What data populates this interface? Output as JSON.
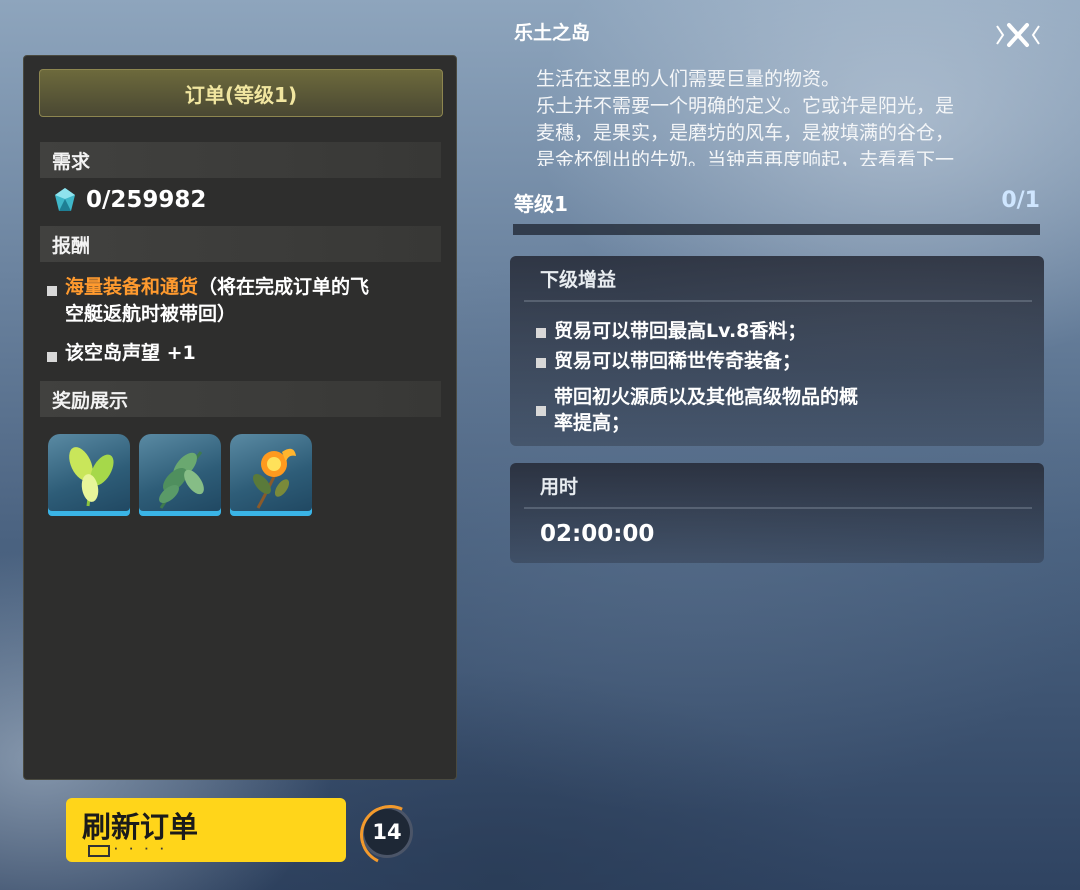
{
  "panel": {
    "title": "订单(等级1)",
    "requirement_label": "需求",
    "requirement_value": "0/259982",
    "reward_label": "报酬",
    "rewards": [
      {
        "highlight": "海量装备和通货",
        "text_line1": "（将在完成订单的飞",
        "text_line2": "空艇返航时被带回）"
      },
      {
        "text": "该空岛声望 +1"
      }
    ],
    "showcase_label": "奖励展示",
    "showcase_items": [
      {
        "icon": "green-leaf-plant-icon"
      },
      {
        "icon": "fern-plant-icon"
      },
      {
        "icon": "fire-flower-icon"
      }
    ]
  },
  "refresh": {
    "label": "刷新订单",
    "dots": "· · · ·",
    "count": "14"
  },
  "island": {
    "title": "乐土之岛",
    "description": [
      "生活在这里的人们需要巨量的物资。",
      "乐土并不需要一个明确的定义。它或许是阳光，是",
      "麦穗，是果实，是磨坊的风车，是被填满的谷仓，",
      "是金杯倒出的牛奶。当钟声再度响起，去看看下一"
    ],
    "level_label": "等级1",
    "level_progress": "0/1",
    "progress_fraction": 0
  },
  "next_buff": {
    "label": "下级增益",
    "items": [
      {
        "line1": "贸易可以带回最高Lv.8香料；"
      },
      {
        "line1": "贸易可以带回稀世传奇装备；"
      },
      {
        "line1": "带回初火源质以及其他高级物品的概",
        "line2": "率提高；"
      }
    ]
  },
  "time": {
    "label": "用时",
    "value": "02:00:00"
  },
  "colors": {
    "accent_yellow": "#ffd51a",
    "highlight_orange": "#ff9a2e",
    "panel_bg": "#2e2e2d"
  }
}
